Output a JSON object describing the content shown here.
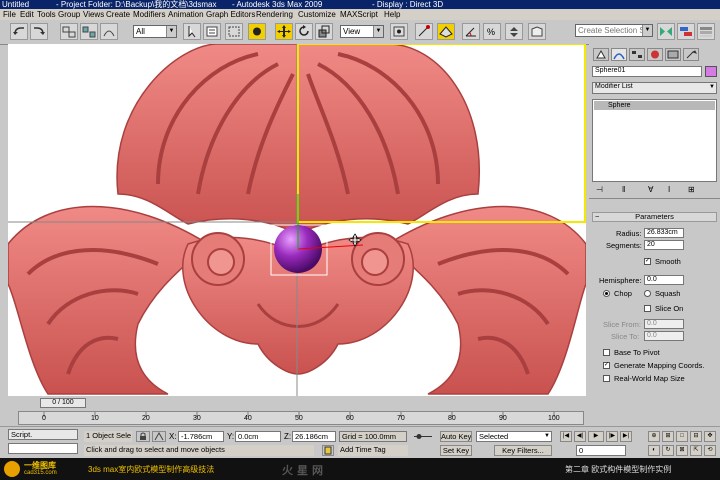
{
  "window": {
    "title_parts": [
      "Untitled",
      "- Project Folder: D:\\Backup\\我的文档\\3dsmax",
      "- Autodesk 3ds Max 2009",
      "- Display : Direct 3D"
    ]
  },
  "menu": [
    "File",
    "Edit",
    "Tools",
    "Group",
    "Views",
    "Create",
    "Modifiers",
    "Animation",
    "Graph Editors",
    "Rendering",
    "Customize",
    "MAXScript",
    "Help"
  ],
  "toolbar": {
    "filter_value": "All",
    "refcoord_value": "View",
    "named_selection_placeholder": "Create Selection Se"
  },
  "command_panel": {
    "object_name": "Sphere01",
    "modifier_list": "Modifier List",
    "stack_item": "Sphere",
    "rollout_title": "Parameters",
    "radius_label": "Radius:",
    "radius_value": "26.833cm",
    "segments_label": "Segments:",
    "segments_value": "20",
    "smooth_label": "Smooth",
    "hemisphere_label": "Hemisphere:",
    "hemisphere_value": "0.0",
    "chop_label": "Chop",
    "squash_label": "Squash",
    "slice_on_label": "Slice On",
    "slice_from_label": "Slice From:",
    "slice_from_value": "0.0",
    "slice_to_label": "Slice To:",
    "slice_to_value": "0.0",
    "base_to_pivot_label": "Base To Pivot",
    "gen_mapping_label": "Generate Mapping Coords.",
    "realworld_label": "Real-World Map Size"
  },
  "timeline": {
    "frame_display": "0 / 100",
    "ticks": [
      "0",
      "10",
      "20",
      "30",
      "40",
      "50",
      "60",
      "70",
      "80",
      "90",
      "100"
    ]
  },
  "status": {
    "maxscript_label": "Script.",
    "selection_info": "1 Object Sele",
    "prompt": "Click and drag to select and move objects",
    "x_label": "X:",
    "x_value": "-1.786cm",
    "y_label": "Y:",
    "y_value": "0.0cm",
    "z_label": "Z:",
    "z_value": "26.186cm",
    "grid": "Grid = 100.0mm",
    "auto_key": "Auto Key",
    "selected": "Selected",
    "set_key": "Set Key",
    "key_filters": "Key Filters...",
    "add_time_tag": "Add Time Tag",
    "current_frame": "0"
  },
  "footer": {
    "logo_text": "一维图库",
    "logo_url": "cad315.com",
    "course_title": "3ds max室内欧式模型制作高级技法",
    "chapter": "第二章 欧式构件模型制作实例",
    "watermark": "火星网"
  },
  "colors": {
    "carving": "#e06d6a",
    "carving_dark": "#a9403f",
    "sphere": "#9a2bbd",
    "selection_yellow": "#f5e800"
  }
}
